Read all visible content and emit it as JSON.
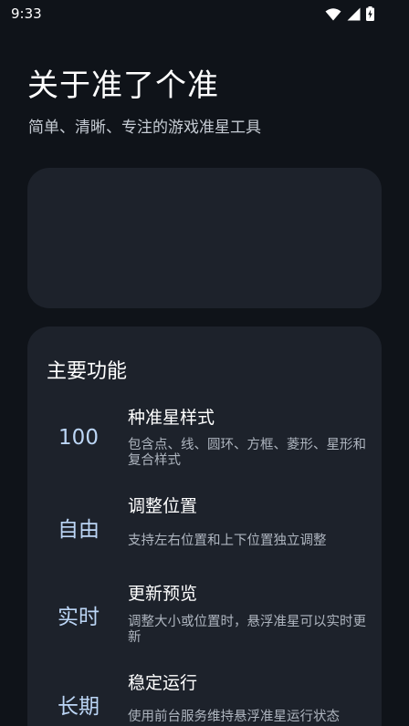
{
  "status_bar": {
    "time": "9:33",
    "icons": [
      "wifi-icon",
      "signal-icon",
      "battery-charging-icon"
    ]
  },
  "about": {
    "title": "关于准了个准",
    "subtitle": "简单、清晰、专注的游戏准星工具"
  },
  "features": {
    "heading": "主要功能",
    "items": [
      {
        "badge": "100",
        "title": "种准星样式",
        "description": "包含点、线、圆环、方框、菱形、星形和复合样式"
      },
      {
        "badge": "自由",
        "title": "调整位置",
        "description": "支持左右位置和上下位置独立调整"
      },
      {
        "badge": "实时",
        "title": "更新预览",
        "description": "调整大小或位置时，悬浮准星可以实时更新"
      },
      {
        "badge": "长期",
        "title": "稳定运行",
        "description": "使用前台服务维持悬浮准星运行状态"
      }
    ]
  },
  "colors": {
    "background": "#0f1319",
    "card": "#1d222b",
    "badge_text": "#bcd6f6"
  }
}
